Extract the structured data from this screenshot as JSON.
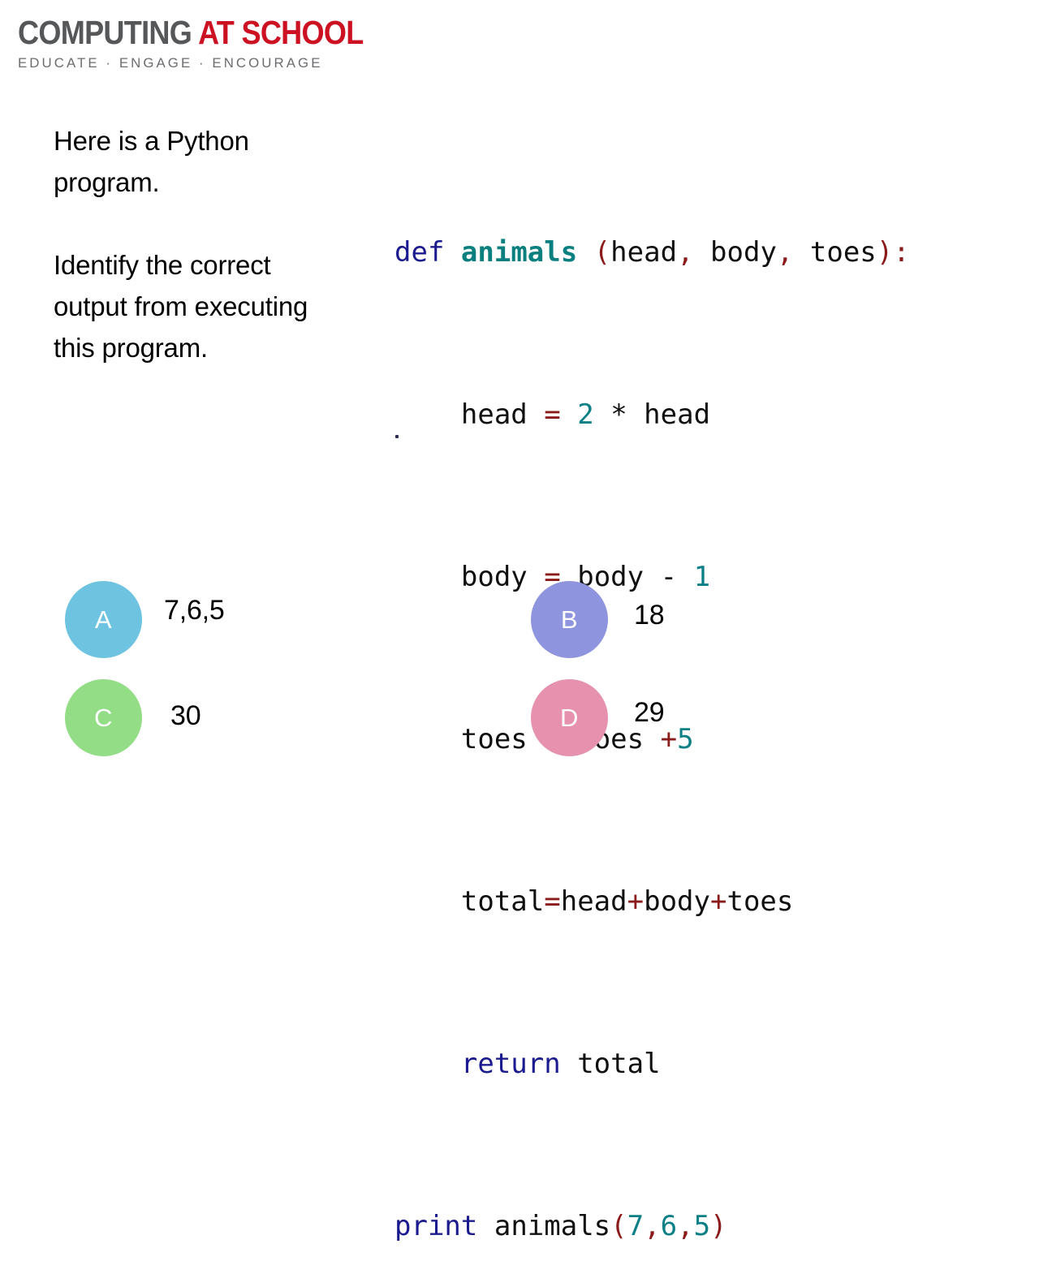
{
  "logo": {
    "word_part1": "COMPUTING ",
    "word_part2": "AT SCHOOL",
    "tagline": "EDUCATE · ENGAGE · ENCOURAGE",
    "grey": "#555759",
    "red": "#cc1122"
  },
  "prose": {
    "paragraph1": "Here is a Python program.",
    "paragraph2": "Identify the correct output from executing this program."
  },
  "code": {
    "line1": {
      "kw": "def",
      "space1": " ",
      "fn": "animals",
      "space2": " ",
      "open": "(",
      "arg1": "head",
      "comma1": ",",
      "sp1": " ",
      "arg2": "body",
      "comma2": ",",
      "sp2": " ",
      "arg3": "toes",
      "close": ")",
      "colon": ":"
    },
    "line2": {
      "indent": "    ",
      "target": "head",
      "sp1": " ",
      "eq": "=",
      "sp2": " ",
      "num": "2",
      "sp3": " ",
      "mul": "*",
      "sp4": " ",
      "operand": "head"
    },
    "line3": {
      "indent": "    ",
      "target": "body",
      "sp1": " ",
      "eq": "=",
      "sp2": " ",
      "operand": "body",
      "sp3": " ",
      "minus": "-",
      "sp4": " ",
      "num": "1"
    },
    "line4": {
      "indent": "    ",
      "target": "toes",
      "sp1": " ",
      "eq": "=",
      "sp2": " ",
      "operand": "toes",
      "sp3": " ",
      "plus": "+",
      "num": "5"
    },
    "line5": {
      "indent": "    ",
      "target": "total",
      "eq": "=",
      "op1": "head",
      "plus1": "+",
      "op2": "body",
      "plus2": "+",
      "op3": "toes"
    },
    "line6": {
      "indent": "    ",
      "kw": "return",
      "sp": " ",
      "value": "total"
    },
    "line7": {
      "kw": "print",
      "sp": " ",
      "fn": "animals",
      "open": "(",
      "num1": "7",
      "comma1": ",",
      "num2": "6",
      "comma2": ",",
      "num3": "5",
      "close": ")"
    },
    "colors": {
      "keyword": "#1b1b8f",
      "function": "#0a7f7f",
      "punctuation": "#8b1a1a",
      "operator": "#8b1a1a",
      "number": "#0a7f86",
      "identifier": "#101010"
    }
  },
  "options": [
    {
      "id": "A",
      "letter": "A",
      "answer": "7,6,5",
      "color": "#6ec4e0"
    },
    {
      "id": "B",
      "letter": "B",
      "answer": "18",
      "color": "#8f94de"
    },
    {
      "id": "C",
      "letter": "C",
      "answer": "30",
      "color": "#92dd85"
    },
    {
      "id": "D",
      "letter": "D",
      "answer": "29",
      "color": "#e692ae"
    }
  ]
}
